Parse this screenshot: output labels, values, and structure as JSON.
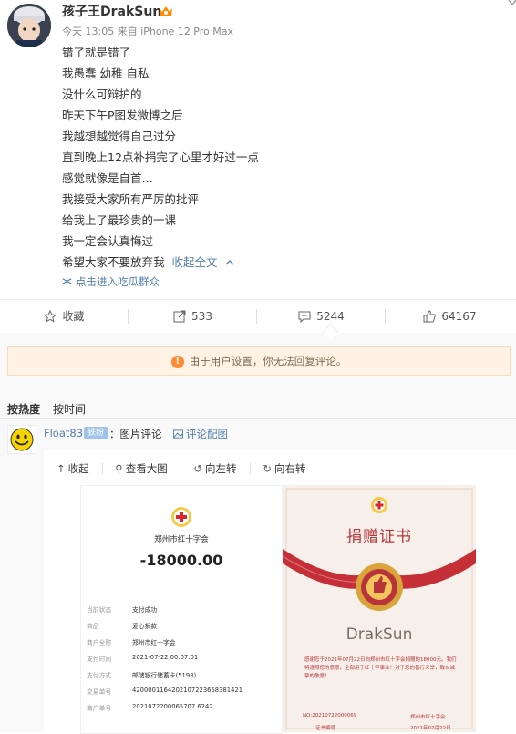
{
  "post": {
    "username": "孩子王DrakSun",
    "meta": "今天 13:05 来自 iPhone 12 Pro Max",
    "lines": [
      "错了就是错了",
      "我愚蠢 幼稚 自私",
      "没什么可辩护的",
      "昨天下午P图发微博之后",
      "我越想越觉得自己过分",
      "直到晚上12点补捐完了心里才好过一点",
      "感觉就像是自首…",
      "我接受大家所有严厉的批评",
      "给我上了最珍贵的一课",
      "我一定会认真悔过",
      "希望大家不要放弃我"
    ],
    "collapse_label": "收起全文",
    "fans_group_link": "点击进入吃瓜群众"
  },
  "actions": {
    "favorite": "收藏",
    "repost": "533",
    "comment": "5244",
    "like": "64167"
  },
  "notice": "由于用户设置，你无法回复评论。",
  "sort": {
    "hot": "按热度",
    "time": "按时间"
  },
  "comment": {
    "user": "Float83",
    "badge": "铁粉",
    "text": "：图片评论",
    "link": "评论配图"
  },
  "viewer": {
    "collapse": "收起",
    "view_large": "查看大图",
    "rotate_left": "向左转",
    "rotate_right": "向右转"
  },
  "receipt": {
    "org": "郑州市红十字会",
    "amount": "-18000.00",
    "rows": [
      {
        "label": "当前状态",
        "value": "支付成功"
      },
      {
        "label": "商品",
        "value": "爱心捐款"
      },
      {
        "label": "商户全称",
        "value": "郑州市红十字会"
      },
      {
        "label": "支付时间",
        "value": "2021-07-22 00:07:01"
      },
      {
        "label": "支付方式",
        "value": "邮储银行储蓄卡(5198)"
      },
      {
        "label": "交易单号",
        "value": "4200001164202107223658381421"
      },
      {
        "label": "商户单号",
        "value": "2021072200065707 6242"
      }
    ]
  },
  "certificate": {
    "title": "捐赠证书",
    "holder": "DrakSun",
    "body": "感谢您于2021年07月22日向郑州市红十字会捐赠的18000元。我们将遵照您的意愿，全部用于红十字事业！对于您的善行义举，致以诚挚的敬意！",
    "cert_no_label": "NO:20210722000069",
    "cert_no_caption": "证书编号",
    "issuer": "郑州市红十字会",
    "date": "2021年07月22日"
  },
  "colors": {
    "link": "#507daf",
    "notice_bg": "#fff3e6",
    "notice_icon": "#ff8a33",
    "cert_red": "#b8333a"
  }
}
